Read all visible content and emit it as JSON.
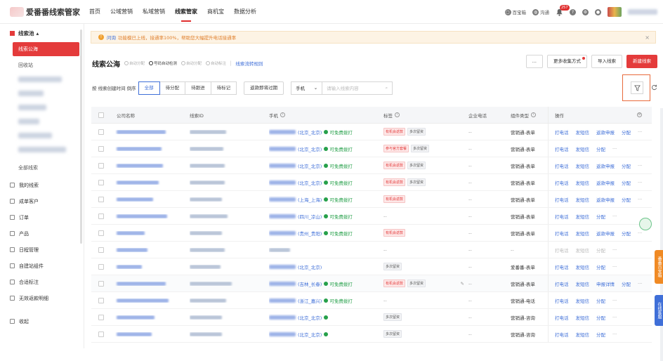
{
  "app": {
    "name": "爱番番线索管家"
  },
  "nav": [
    "首页",
    "公域营销",
    "私域营销",
    "线索管家",
    "商机宝",
    "数据分析"
  ],
  "top_right": {
    "baicaibao": "百宝箱",
    "qiaoqiao": "沟通",
    "badge": "257"
  },
  "sidebar": {
    "group": "线索池",
    "sub": [
      "线索公海",
      "回收站"
    ],
    "all": "全部线索",
    "items": [
      "我的线索",
      "成单客户",
      "订单",
      "产品",
      "日程管理",
      "自建站组件",
      "合适标注",
      "无效返款明细",
      "收起"
    ]
  },
  "alert": {
    "link": "问询",
    "text": "功能模已上线，接通率100%，帮助您大幅提升电话接通率"
  },
  "header": {
    "title": "线索公海",
    "flags": [
      "自动分配",
      "号码自动检测",
      "自动分配",
      "自动标注"
    ],
    "rule": "线索流转规则",
    "more": "...",
    "collect": "更多收集方式",
    "import": "导入线索",
    "create": "新建线索"
  },
  "filter": {
    "sort": "按 线索创建时间 倒序",
    "tabs": [
      "全部",
      "待分配",
      "待跟进",
      "待标记"
    ],
    "expiring": "返款即将过期",
    "select": "手机",
    "placeholder": "请输入线索内容"
  },
  "columns": [
    "公司名称",
    "线索ID",
    "手机",
    "标签",
    "企业电话",
    "组件类型",
    "操作"
  ],
  "rows": [
    {
      "region": "(北京_北京)",
      "free": "可免费拨打",
      "tags": [
        [
          "有机会返款",
          "red"
        ],
        [
          "多次留资",
          "gray"
        ]
      ],
      "type": "营销通-表单",
      "ops": [
        "打电话",
        "发短信",
        "返款申报",
        "分配"
      ]
    },
    {
      "region": "(北京_北京)",
      "free": "可免费拨打",
      "tags": [
        [
          "参与官方套餐",
          "red"
        ],
        [
          "多次留资",
          "gray"
        ]
      ],
      "type": "营销通-表单",
      "ops": [
        "打电话",
        "发短信",
        "分配"
      ]
    },
    {
      "region": "(北京_北京)",
      "free": "可免费拨打",
      "tags": [
        [
          "有机会返款",
          "red"
        ],
        [
          "多次留资",
          "gray"
        ]
      ],
      "type": "营销通-表单",
      "ops": [
        "打电话",
        "发短信",
        "返款申报",
        "分配"
      ]
    },
    {
      "region": "(北京_北京)",
      "free": "可免费拨打",
      "tags": [
        [
          "有机会返款",
          "red"
        ],
        [
          "多次留资",
          "gray"
        ]
      ],
      "type": "营销通-表单",
      "ops": [
        "打电话",
        "发短信",
        "返款申报",
        "分配"
      ]
    },
    {
      "region": "(上海_上海)",
      "free": "可免费拨打",
      "tags": [
        [
          "有机会返款",
          "red"
        ]
      ],
      "type": "营销通-表单",
      "ops": [
        "打电话",
        "发短信",
        "返款申报",
        "分配"
      ]
    },
    {
      "region": "(四川_凉山)",
      "free": "可免费拨打",
      "tags": [],
      "type": "营销通-表单",
      "ops": [
        "打电话",
        "发短信",
        "分配"
      ]
    },
    {
      "region": "(贵州_贵阳)",
      "free": "可免费拨打",
      "tags": [
        [
          "有机会返款",
          "red"
        ]
      ],
      "type": "营销通-表单",
      "ops": [
        "打电话",
        "发短信",
        "返款申报",
        "分配"
      ]
    },
    {
      "region": "",
      "free": "",
      "tags": [],
      "type": "",
      "ops": [
        "打电话",
        "发短信",
        "分配"
      ],
      "dis": true
    },
    {
      "region": "(北京_北京)",
      "free": "",
      "tags": [
        [
          "多次留资",
          "gray"
        ]
      ],
      "type": "爱番番-表单",
      "ops": [
        "打电话",
        "发短信",
        "分配"
      ]
    },
    {
      "region": "(吉林_长春)",
      "free": "可免费拨打",
      "tags": [
        [
          "有机会返款",
          "red"
        ],
        [
          "多次留资",
          "gray"
        ]
      ],
      "type": "营销通-表单",
      "ops": [
        "打电话",
        "发短信",
        "申报详情",
        "分配"
      ]
    },
    {
      "region": "(浙江_嘉兴)",
      "free": "可免费拨打",
      "tags": [],
      "type": "营销通-电话",
      "ops": [
        "打电话",
        "发短信",
        "分配"
      ]
    },
    {
      "region": "(北京_北京)",
      "free": "",
      "tags": [
        [
          "多次留资",
          "gray"
        ]
      ],
      "type": "营销通-咨询",
      "ops": [
        "打电话",
        "发短信",
        "分配"
      ]
    },
    {
      "region": "(北京_北京)",
      "free": "",
      "tags": [
        [
          "多次留资",
          "gray"
        ]
      ],
      "type": "营销通-咨询",
      "ops": [
        "打电话",
        "发短信",
        "分配"
      ]
    }
  ],
  "floats": {
    "orange": "番番百宝箱",
    "blue": "在线客服"
  }
}
